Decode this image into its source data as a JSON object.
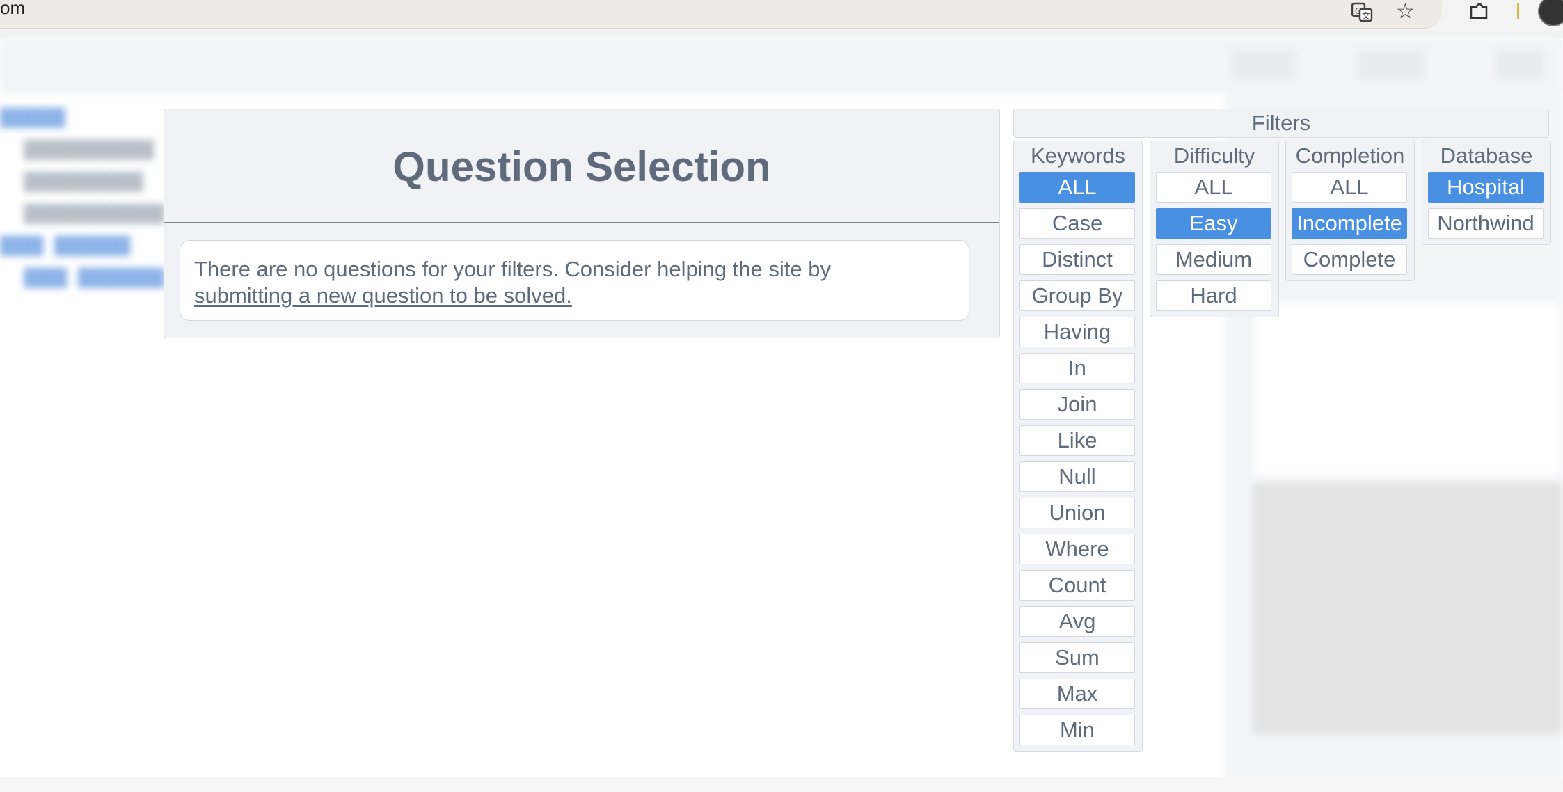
{
  "browser": {
    "url_fragment": "om",
    "icons": [
      "translate-icon",
      "star-icon",
      "extensions-icon",
      "profile-avatar"
    ]
  },
  "main": {
    "title": "Question Selection",
    "message": "There are no questions for your filters. Consider helping the site by",
    "link_text": "submitting a new question to be solved."
  },
  "filters": {
    "header": "Filters",
    "keywords": {
      "title": "Keywords",
      "selected": "ALL",
      "options": [
        "ALL",
        "Case",
        "Distinct",
        "Group By",
        "Having",
        "In",
        "Join",
        "Like",
        "Null",
        "Union",
        "Where",
        "Count",
        "Avg",
        "Sum",
        "Max",
        "Min"
      ]
    },
    "difficulty": {
      "title": "Difficulty",
      "selected": "Easy",
      "options": [
        "ALL",
        "Easy",
        "Medium",
        "Hard"
      ]
    },
    "completion": {
      "title": "Completion",
      "selected": "Incomplete",
      "options": [
        "ALL",
        "Incomplete",
        "Complete"
      ]
    },
    "database": {
      "title": "Database",
      "selected": "Hospital",
      "options": [
        "Hospital",
        "Northwind"
      ]
    }
  },
  "colors": {
    "accent": "#4a90e2",
    "text": "#5f6b7a",
    "panel": "#f0f2f5"
  }
}
